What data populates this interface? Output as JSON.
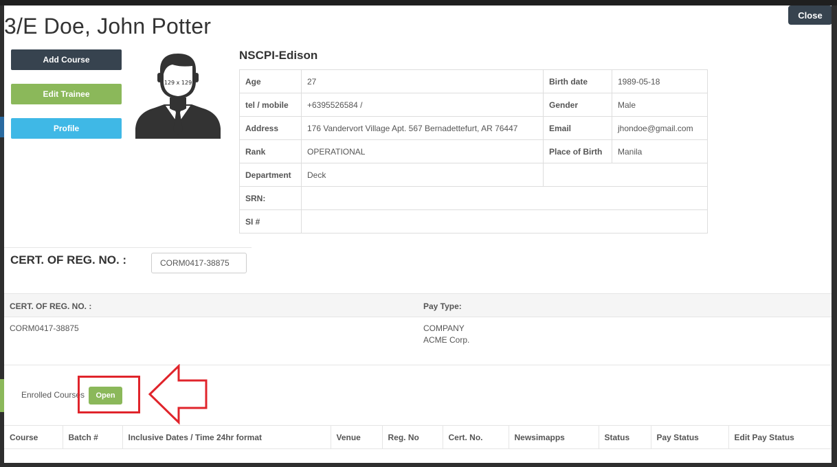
{
  "modal": {
    "title": "3/E Doe, John Potter",
    "close_label": "Close"
  },
  "actions": {
    "add_course": "Add Course",
    "edit_trainee": "Edit Trainee",
    "profile": "Profile"
  },
  "avatar": {
    "size_label": "129 x 129"
  },
  "trainee": {
    "org": "NSCPI-Edison",
    "age_label": "Age",
    "age": "27",
    "birth_date_label": "Birth date",
    "birth_date": "1989-05-18",
    "tel_label": "tel / mobile",
    "tel": "+6395526584 /",
    "gender_label": "Gender",
    "gender": "Male",
    "address_label": "Address",
    "address": "176 Vandervort Village Apt. 567 Bernadettefurt, AR 76447",
    "email_label": "Email",
    "email": "jhondoe@gmail.com",
    "rank_label": "Rank",
    "rank": "OPERATIONAL",
    "pob_label": "Place of Birth",
    "pob": "Manila",
    "department_label": "Department",
    "department": "Deck",
    "srn_label": "SRN:",
    "srn": "",
    "si_label": "SI #",
    "si": ""
  },
  "cert": {
    "label": "CERT. OF REG. NO. :",
    "value": "CORM0417-38875"
  },
  "pay": {
    "cert_header": "CERT. OF REG. NO. :",
    "pay_type_header": "Pay Type:",
    "cert_value": "CORM0417-38875",
    "pay_type": "COMPANY",
    "company": "ACME Corp."
  },
  "enrolled": {
    "label": "Enrolled Courses",
    "open_label": "Open"
  },
  "courses_table": {
    "columns": [
      "Course",
      "Batch #",
      "Inclusive Dates / Time 24hr format",
      "Venue",
      "Reg. No",
      "Cert. No.",
      "Newsimapps",
      "Status",
      "Pay Status",
      "Edit Pay Status"
    ]
  },
  "colors": {
    "dark": "#37434f",
    "green": "#8bb85a",
    "blue": "#3fb8e6",
    "highlight": "#e0242b"
  }
}
